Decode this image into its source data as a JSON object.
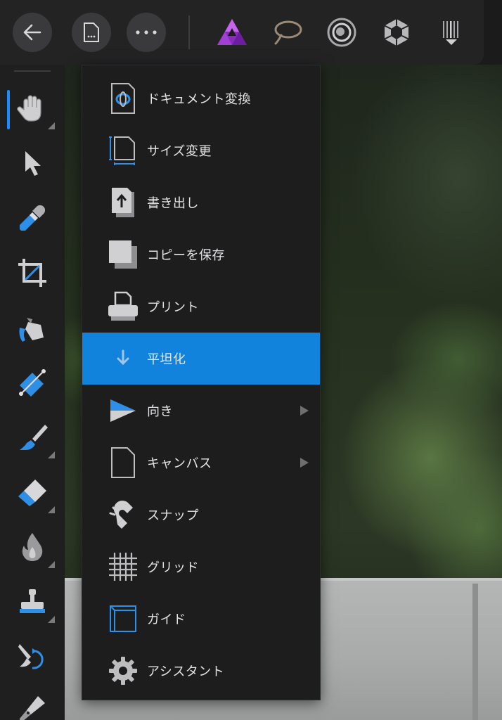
{
  "topbar": {
    "buttons": [
      {
        "icon": "back-arrow-icon"
      },
      {
        "icon": "document-icon"
      },
      {
        "icon": "more-icon"
      }
    ],
    "personas": [
      {
        "icon": "photo-persona-icon",
        "active": true
      },
      {
        "icon": "liquify-persona-icon"
      },
      {
        "icon": "develop-persona-icon"
      },
      {
        "icon": "tone-mapping-persona-icon"
      },
      {
        "icon": "export-persona-icon"
      }
    ]
  },
  "tools": [
    {
      "icon": "hand-icon",
      "active": true
    },
    {
      "icon": "move-icon"
    },
    {
      "icon": "color-picker-icon"
    },
    {
      "icon": "crop-icon"
    },
    {
      "icon": "paint-bucket-icon"
    },
    {
      "icon": "gradient-icon"
    },
    {
      "icon": "paint-brush-icon"
    },
    {
      "icon": "eraser-icon"
    },
    {
      "icon": "burn-icon"
    },
    {
      "icon": "clone-stamp-icon"
    },
    {
      "icon": "undo-brush-icon"
    },
    {
      "icon": "pen-icon"
    }
  ],
  "menu": {
    "items": [
      {
        "label": "ドキュメント変換",
        "icon": "convert-document-icon"
      },
      {
        "label": "サイズ変更",
        "icon": "resize-icon"
      },
      {
        "label": "書き出し",
        "icon": "export-icon"
      },
      {
        "label": "コピーを保存",
        "icon": "save-copy-icon"
      },
      {
        "label": "プリント",
        "icon": "print-icon"
      },
      {
        "label": "平坦化",
        "icon": "flatten-icon",
        "highlighted": true
      },
      {
        "label": "向き",
        "icon": "orientation-icon",
        "submenu": true
      },
      {
        "label": "キャンバス",
        "icon": "canvas-icon",
        "submenu": true
      },
      {
        "label": "スナップ",
        "icon": "snap-magnet-icon"
      },
      {
        "label": "グリッド",
        "icon": "grid-icon"
      },
      {
        "label": "ガイド",
        "icon": "guides-icon"
      },
      {
        "label": "アシスタント",
        "icon": "assistant-gear-icon"
      }
    ],
    "highlight_color": "#1183dc"
  },
  "colors": {
    "accent": "#1a8cff",
    "persona_purple": "#b04ad8"
  }
}
